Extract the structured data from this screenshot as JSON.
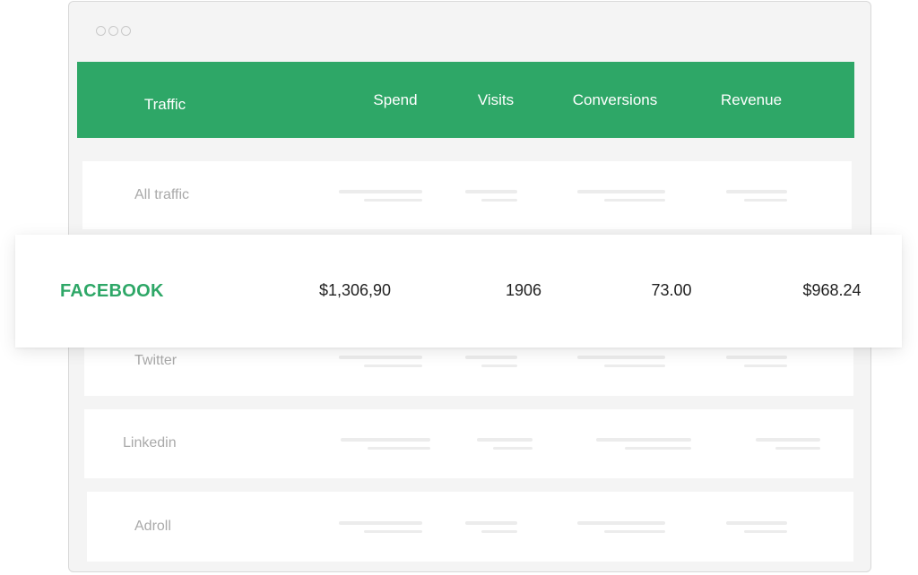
{
  "window": {
    "controls": [
      "circle-icon",
      "circle-icon",
      "circle-icon"
    ]
  },
  "colors": {
    "accent": "#2ea767",
    "muted_text": "#a9a9a9",
    "placeholder_bar": "#ececec"
  },
  "table": {
    "headers": {
      "traffic": "Traffic",
      "spend": "Spend",
      "visits": "Visits",
      "conversions": "Conversions",
      "revenue": "Revenue"
    },
    "rows": {
      "all_traffic": "All traffic",
      "twitter": "Twitter",
      "linkedin": "Linkedin",
      "adroll": "Adroll"
    },
    "highlight": {
      "name": "FACEBOOK",
      "spend": "$1,306,90",
      "visits": "1906",
      "conversions": "73.00",
      "revenue": "$968.24"
    }
  }
}
